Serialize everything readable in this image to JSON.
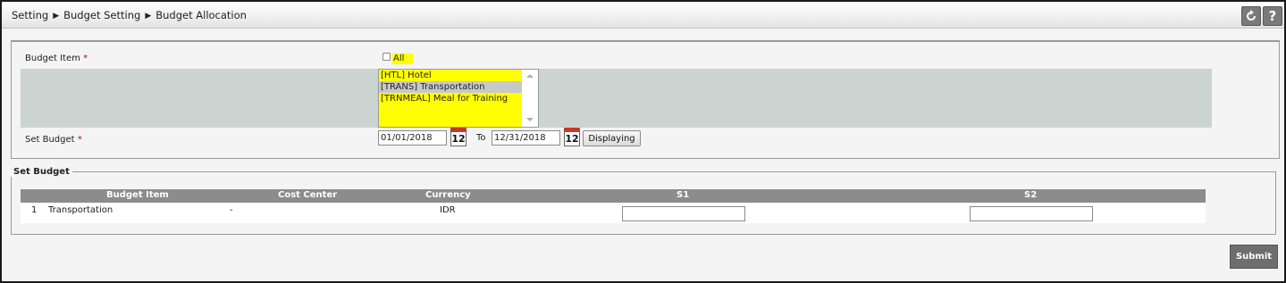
{
  "breadcrumb": {
    "item1": "Setting",
    "sep": "▶",
    "item2": "Budget Setting",
    "item3": "Budget Allocation"
  },
  "header_buttons": {
    "refresh_icon": "refresh-icon",
    "help_label": "?"
  },
  "filter": {
    "budget_item_label": "Budget Item",
    "required_mark": "*",
    "all_label": "All",
    "all_checked": false,
    "options": [
      {
        "label": "[HTL] Hotel",
        "selected": false
      },
      {
        "label": "[TRANS] Transportation",
        "selected": true
      },
      {
        "label": "[TRNMEAL] Meal for Training",
        "selected": false
      }
    ],
    "set_budget_label": "Set Budget",
    "date_from": "01/01/2018",
    "date_to": "12/31/2018",
    "to_label": "To",
    "calendar_text": "12",
    "displaying_button": "Displaying"
  },
  "set_budget": {
    "legend": "Set Budget",
    "columns": [
      "Budget Item",
      "Cost Center",
      "Currency",
      "S1",
      "S2"
    ],
    "rows": [
      {
        "no": "1",
        "item": "Transportation",
        "cost_center": "-",
        "currency": "IDR",
        "s1": "",
        "s2": ""
      }
    ]
  },
  "submit_label": "Submit",
  "colors": {
    "highlight": "#ffff00",
    "header_gray": "#8c8c8c",
    "strip": "#cbd4d0",
    "required": "#cc0000"
  }
}
